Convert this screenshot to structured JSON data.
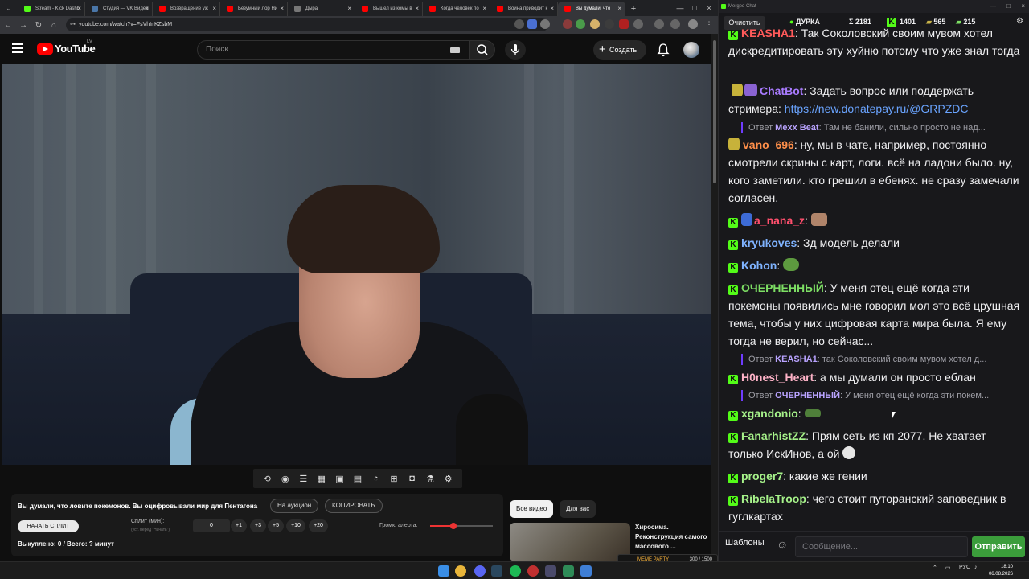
{
  "browser": {
    "tabs": [
      {
        "label": "Stream - Kick Dashb",
        "color": "#53fc18"
      },
      {
        "label": "Студия — VK Видео",
        "color": "#4a76a8"
      },
      {
        "label": "Возвращение уж",
        "color": "#ff0000"
      },
      {
        "label": "Безумный лор Ни",
        "color": "#ff0000"
      },
      {
        "label": "Дыра",
        "color": "#777777"
      },
      {
        "label": "Вышел из комы в",
        "color": "#ff0000"
      },
      {
        "label": "Когда человек по",
        "color": "#ff0000"
      },
      {
        "label": "Война приводит к",
        "color": "#ff0000"
      },
      {
        "label": "Вы думали, что",
        "color": "#ff0000"
      }
    ],
    "url": "youtube.com/watch?v=FsVhInKZsbM"
  },
  "youtube": {
    "logo_text": "YouTube",
    "region": "LV",
    "search_placeholder": "Поиск",
    "create_label": "Создать"
  },
  "extension_bar": {
    "icons": [
      "loop-icon",
      "broadcast-icon",
      "playlist-icon",
      "clapper-icon",
      "pip-icon",
      "miniplayer-icon",
      "speed-icon",
      "caption-icon",
      "camera-icon",
      "flask-icon",
      "gear-icon"
    ]
  },
  "info_panel": {
    "title": "Вы думали, что ловите покемонов. Вы оцифровывали мир для Пентагона",
    "auction_label": "На аукцион",
    "copy_label": "КОПИРОВАТЬ",
    "split_button": "НАЧАТЬ СПЛИТ",
    "split_label": "Сплит (мин):",
    "split_hint": "(уст. перед \"Начать\")",
    "split_value": "0",
    "increments": [
      "+1",
      "+3",
      "+5",
      "+10",
      "+20"
    ],
    "volume_label": "Громк. алерта:",
    "volume_level": 0.37,
    "bought": "Выкуплено: 0 / Всего: ? минут"
  },
  "recommendations": {
    "tab_all": "Все видео",
    "tab_for_you": "Для вас",
    "card_title": "Хиросима. Реконструкция самого массового ..."
  },
  "meme_party": {
    "label": "MEME PARTY",
    "count": "300 / 1500"
  },
  "chat": {
    "window_title": "Merged Chat",
    "clear_label": "Очистить",
    "stats": {
      "channel": "ДУРКА",
      "total": "Σ 2181",
      "kick": "1401",
      "other": "565",
      "vk": "215"
    },
    "messages": [
      {
        "name": "KEASHA1",
        "color": "#ff5a5a",
        "text": ": Так Соколовский своим мувом хотел дискредитировать эту хуйню потому что уже знал тогда"
      },
      {
        "name": "ChatBot",
        "color": "#a97bff",
        "text": ": Задать вопрос или поддержать стримера: ",
        "link": "https://new.donatepay.ru/@GRPZDC"
      },
      {
        "name": "vano_696",
        "color": "#ff8f4a",
        "text": ": ну, мы в чате, например, постоянно смотрели скрины с карт, логи. всё на ладони было. ну, кого заметили. кто грешил в ебенях. не сразу замечали согласен."
      },
      {
        "name": "a_nana_z",
        "color": "#ff4f6d",
        "text": ":"
      },
      {
        "name": "kryukoves",
        "color": "#7fb3ff",
        "text": ": Зд модель делали"
      },
      {
        "name": "Kohon",
        "color": "#7fb3ff",
        "text": ":"
      },
      {
        "name": "ОЧЕРНЕННЫЙ",
        "color": "#7ddf64",
        "text": ": У меня отец ещё когда эти покемоны появились мне говорил мол это всё црушная тема, чтобы у них цифровая карта мира была. Я ему тогда не верил, но сейчас..."
      },
      {
        "name": "H0nest_Heart",
        "color": "#ffb3c8",
        "text": ": а мы думали он просто еблан"
      },
      {
        "name": "xgandonio",
        "color": "#a6f28a",
        "text": ":"
      },
      {
        "name": "FanarhistZZ",
        "color": "#a6f28a",
        "text": ": Прям сеть из кп 2077. Не хватает только ИскИнов, а ой"
      },
      {
        "name": "proger7",
        "color": "#a6f28a",
        "text": ": какие же гении"
      },
      {
        "name": "RibelaTroop",
        "color": "#a6f28a",
        "text": ": чего стоит путоранский заповедник в гуглкартах"
      }
    ],
    "replies": [
      {
        "prefix": "Ответ",
        "name": "Mexx Beat",
        "text": ": Там не банили, сильно просто не над..."
      },
      {
        "prefix": "Ответ",
        "name": "KEASHA1",
        "text": ": так Соколовский своим мувом хотел д..."
      },
      {
        "prefix": "Ответ",
        "name": "ОЧЕРНЕННЫЙ",
        "text": ": У меня отец ещё когда эти покем..."
      }
    ],
    "templates_label": "Шаблоны",
    "input_placeholder": "Сообщение...",
    "send_label": "Отправить"
  },
  "taskbar": {
    "lang": "РУС",
    "time": "18:10",
    "date": "06.08.2026"
  }
}
